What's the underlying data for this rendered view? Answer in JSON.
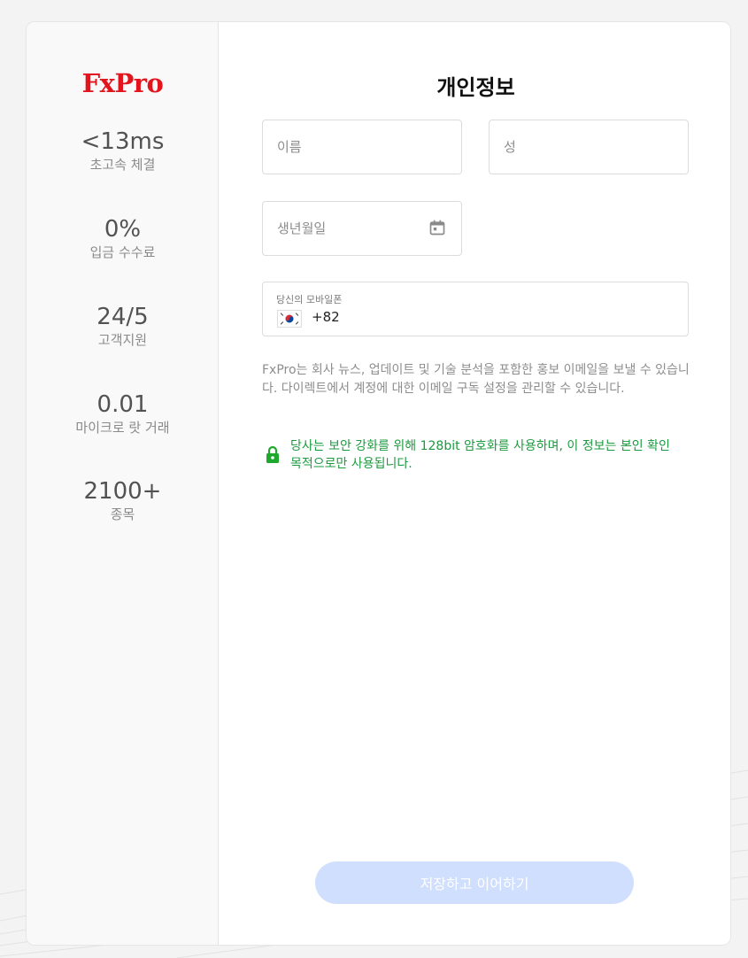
{
  "brand": {
    "logo_text": "FxPro",
    "logo_color": "#e3141b"
  },
  "stats": [
    {
      "value": "<13ms",
      "label": "초고속 체결"
    },
    {
      "value": "0%",
      "label": "입금 수수료"
    },
    {
      "value": "24/5",
      "label": "고객지원"
    },
    {
      "value": "0.01",
      "label": "마이크로 랏 거래"
    },
    {
      "value": "2100+",
      "label": "종목"
    }
  ],
  "form": {
    "title": "개인정보",
    "first_name_placeholder": "이름",
    "last_name_placeholder": "성",
    "birthdate_placeholder": "생년월일",
    "calendar_icon": "calendar-icon",
    "phone": {
      "label": "당신의 모바일폰",
      "country_flag": "south-korea-flag",
      "dial_code": "+82"
    },
    "marketing_notice": "FxPro는 회사 뉴스, 업데이트 및 기술 분석을 포함한 홍보 이메일을 보낼 수 있습니다. 다이렉트에서 계정에 대한 이메일 구독 설정을 관리할 수 있습니다.",
    "security_notice": "당사는 보안 강화를 위해 128bit 암호화를 사용하며, 이 정보는 본인 확인 목적으로만 사용됩니다.",
    "lock_icon": "lock-icon",
    "submit_label": "저장하고 이어하기"
  },
  "colors": {
    "secure_green": "#1b9a3e",
    "submit_disabled": "#cfdffd",
    "background": "#f3f3f3"
  }
}
